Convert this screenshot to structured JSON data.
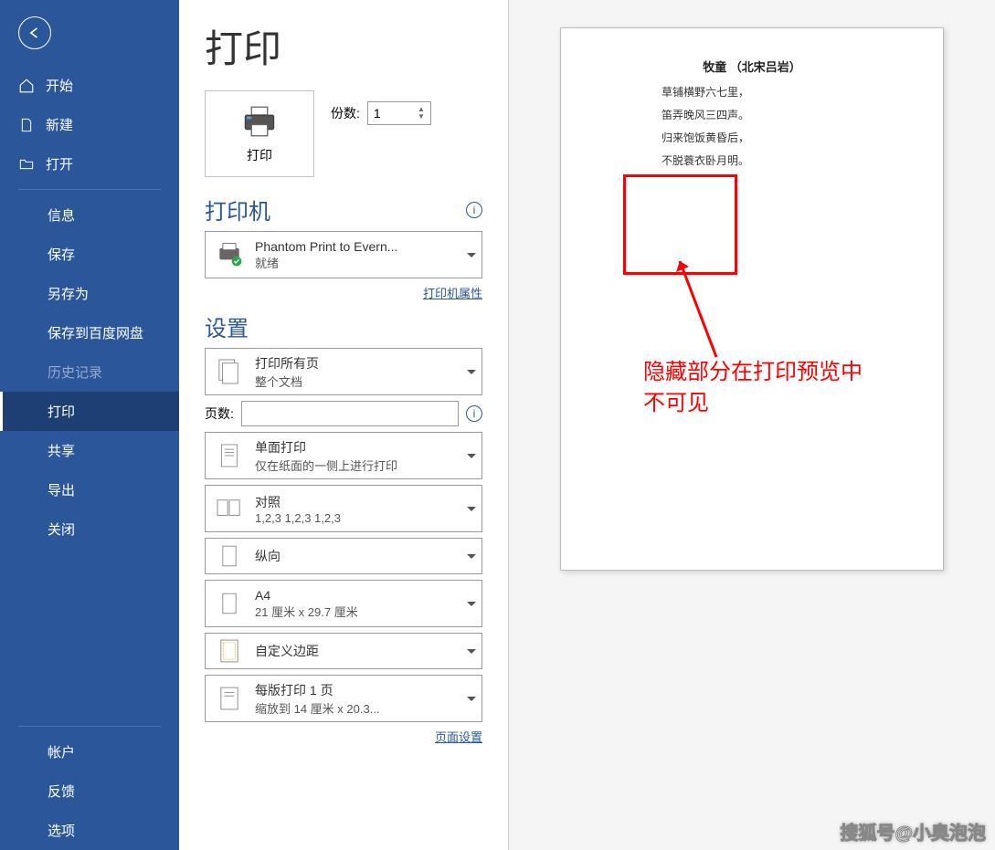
{
  "sidebar": {
    "home": "开始",
    "new": "新建",
    "open": "打开",
    "info": "信息",
    "save": "保存",
    "saveas": "另存为",
    "baidu": "保存到百度网盘",
    "history": "历史记录",
    "print": "打印",
    "share": "共享",
    "export": "导出",
    "close": "关闭",
    "account": "帐户",
    "feedback": "反馈",
    "options": "选项"
  },
  "page_title": "打印",
  "print_button_label": "打印",
  "copies_label": "份数:",
  "copies_value": "1",
  "printer_section": "打印机",
  "printer": {
    "name": "Phantom Print to Evern...",
    "status": "就绪"
  },
  "printer_properties_link": "打印机属性",
  "settings_section": "设置",
  "pages_label": "页数:",
  "pages_value": "",
  "dd_scope": {
    "title": "打印所有页",
    "sub": "整个文档"
  },
  "dd_sides": {
    "title": "单面打印",
    "sub": "仅在纸面的一侧上进行打印"
  },
  "dd_collate": {
    "title": "对照",
    "sub": "1,2,3    1,2,3    1,2,3"
  },
  "dd_orient": {
    "title": "纵向"
  },
  "dd_paper": {
    "title": "A4",
    "sub": "21 厘米 x 29.7 厘米"
  },
  "dd_margins": {
    "title": "自定义边距"
  },
  "dd_sheets": {
    "title": "每版打印 1 页",
    "sub": "缩放到 14 厘米 x 20.3..."
  },
  "page_setup_link": "页面设置",
  "preview": {
    "title": "牧童  （北宋吕岩）",
    "lines": [
      "草铺横野六七里，",
      "笛弄晚风三四声。",
      "归来饱饭黄昏后，",
      "不脱蓑衣卧月明。"
    ]
  },
  "annotation": {
    "line1": "隐藏部分在打印预览中",
    "line2": "不可见"
  },
  "watermark": "搜狐号@小奥泡泡"
}
